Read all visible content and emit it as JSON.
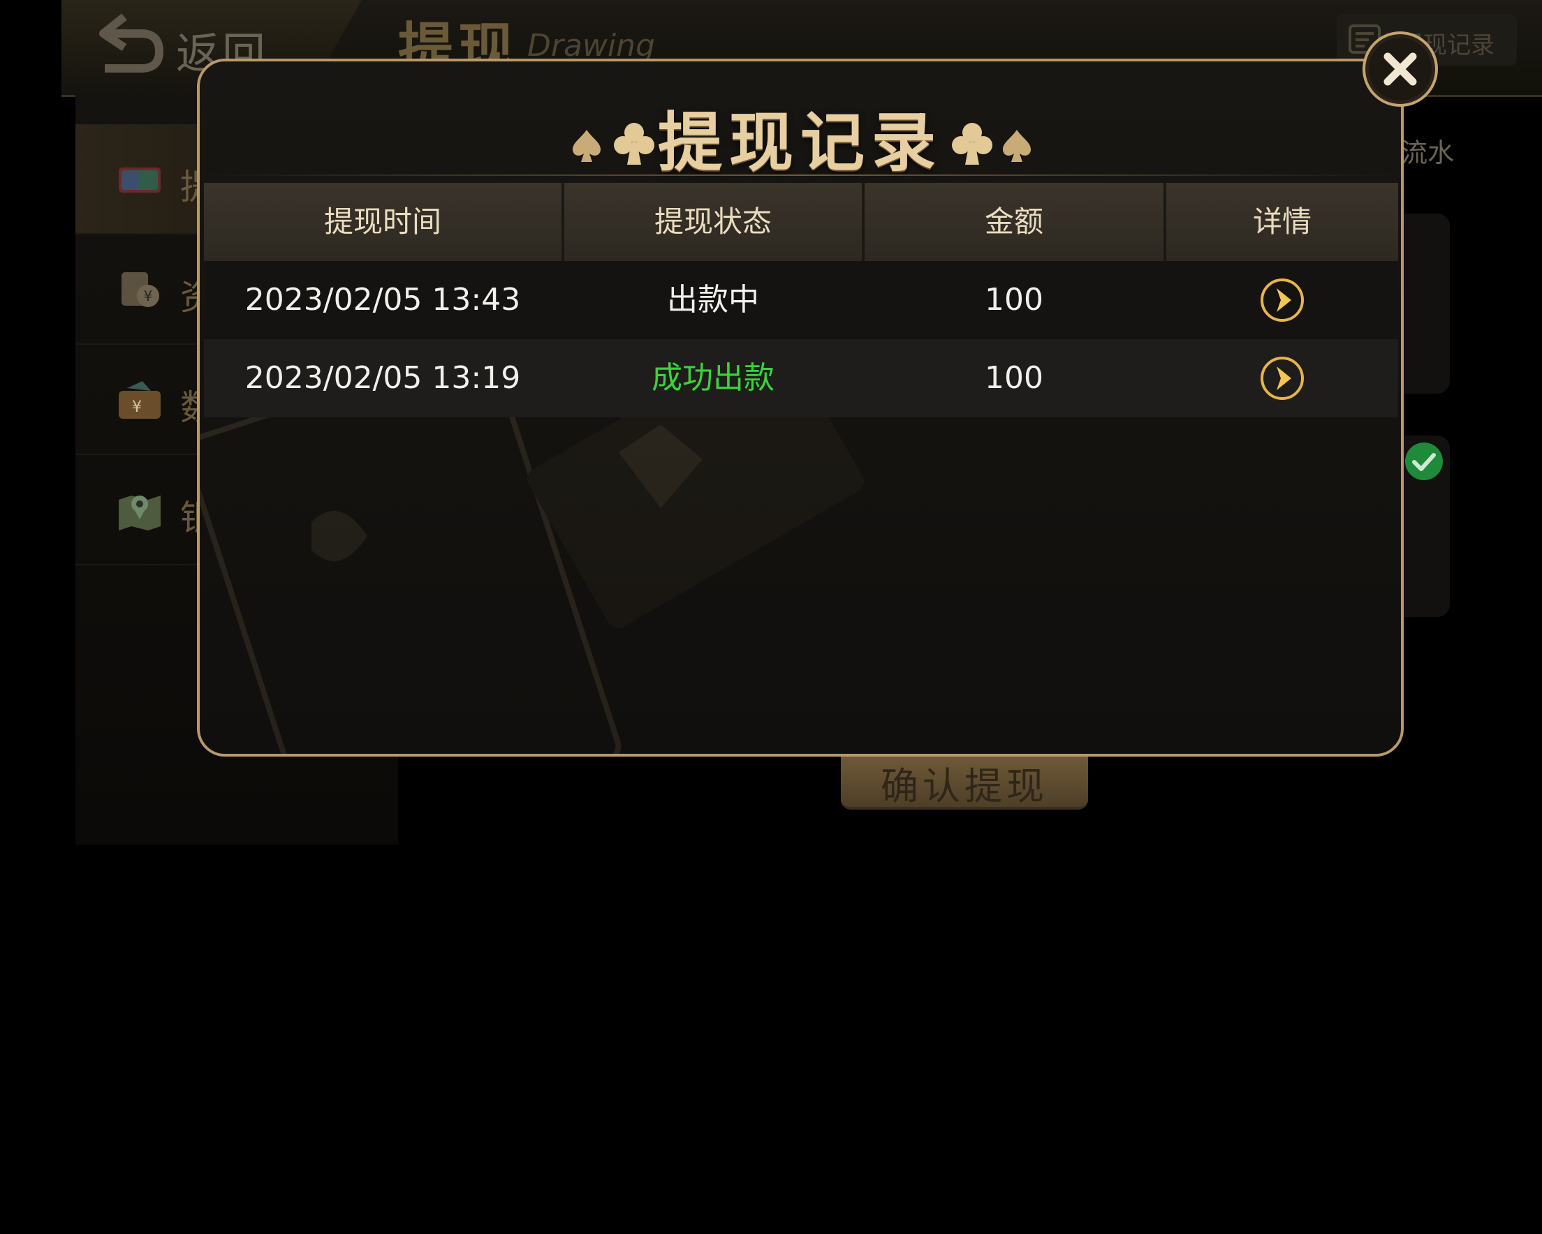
{
  "background": {
    "back_label": "返回",
    "page_title": "提现",
    "page_subtitle": "Drawing",
    "record_button_label": "提现记录",
    "flow_label": "流水",
    "confirm_button_label": "确认提现",
    "sidebar": {
      "items": [
        {
          "label": "提",
          "icon": "unionpay-card-icon"
        },
        {
          "label": "资",
          "icon": "yen-document-icon"
        },
        {
          "label": "数",
          "icon": "yen-wallet-icon"
        },
        {
          "label": "银",
          "icon": "map-pin-icon"
        }
      ]
    }
  },
  "modal": {
    "title": "提现记录",
    "columns": [
      "提现时间",
      "提现状态",
      "金额",
      "详情"
    ],
    "rows": [
      {
        "time": "2023/02/05 13:43",
        "status": "出款中",
        "status_type": "pending",
        "amount": "100"
      },
      {
        "time": "2023/02/05 13:19",
        "status": "成功出款",
        "status_type": "success",
        "amount": "100"
      }
    ]
  },
  "colors": {
    "gold_border": "#b9996a",
    "title_gold": "#e7cfa2",
    "success_green": "#3bd33b",
    "header_bg": "#332e26"
  }
}
